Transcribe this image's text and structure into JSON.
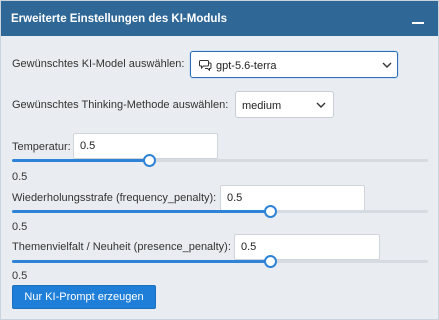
{
  "panel": {
    "title": "Erweiterte Einstellungen des KI-Moduls",
    "collapse_icon": "minus-icon"
  },
  "model": {
    "label": "Gewünschtes KI-Model auswählen:",
    "value": "gpt-5.6-terra",
    "icon": "chat-bubbles-icon"
  },
  "thinking": {
    "label": "Gewünschtes Thinking-Methode auswählen:",
    "value": "medium"
  },
  "temperature": {
    "label": "Temperatur:",
    "input_value": "0.5",
    "slider_fraction": 0.33,
    "value_text": "0.5"
  },
  "frequency": {
    "label": "Wiederholungsstrafe (frequency_penalty):",
    "input_value": "0.5",
    "slider_fraction": 0.62,
    "value_text": "0.5"
  },
  "presence": {
    "label": "Themenvielfalt / Neuheit (presence_penalty):",
    "input_value": "0.5",
    "slider_fraction": 0.62,
    "value_text": "0.5"
  },
  "actions": {
    "generate_label": "Nur KI-Prompt erzeugen"
  },
  "colors": {
    "header": "#2f6797",
    "accent": "#2f83d6",
    "panel_bg": "#e9edf1"
  }
}
